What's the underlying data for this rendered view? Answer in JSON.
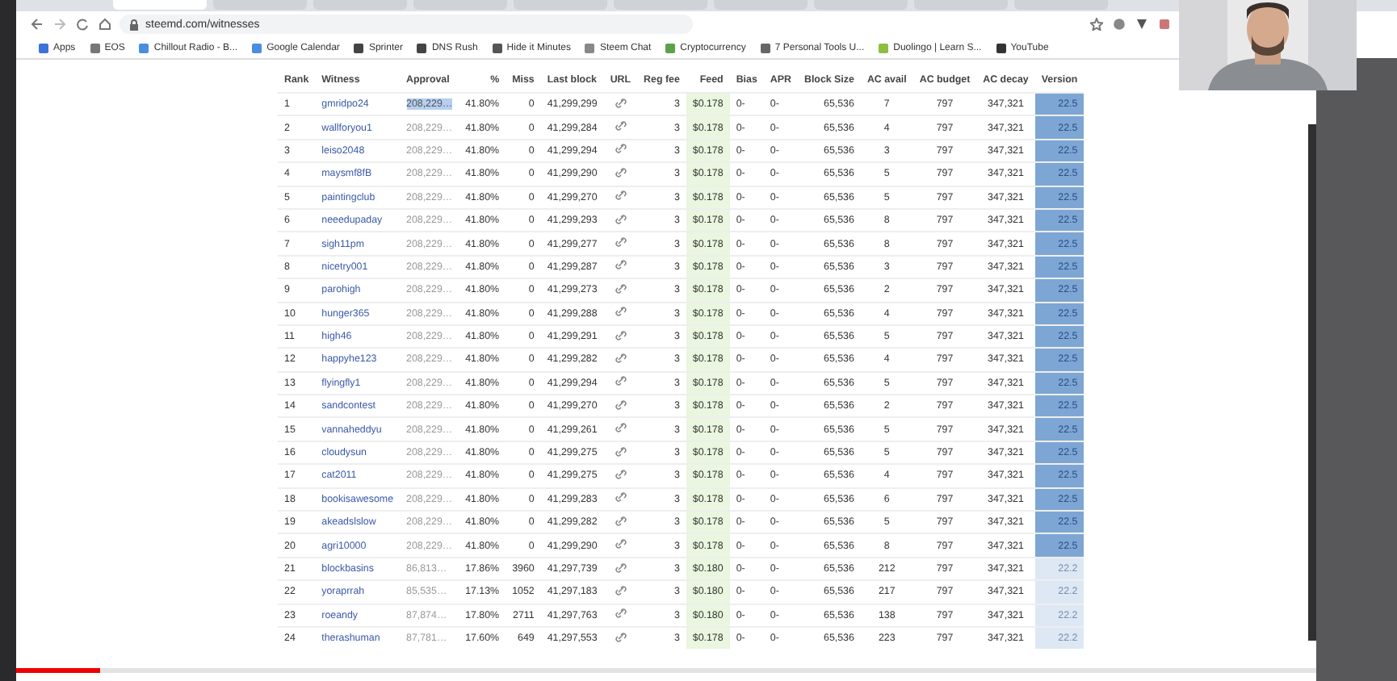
{
  "browser": {
    "tabs": [
      {
        "selected": true
      },
      {
        "selected": false
      },
      {
        "selected": false
      },
      {
        "selected": false
      },
      {
        "selected": false
      },
      {
        "selected": false
      },
      {
        "selected": false
      },
      {
        "selected": false
      },
      {
        "selected": false
      },
      {
        "selected": false
      }
    ],
    "address": "steemd.com/witnesses",
    "bookmarks": [
      "Apps",
      "EOS",
      "Chillout Radio - B...",
      "Google Calendar",
      "Sprinter",
      "DNS Rush",
      "Hide it Minutes",
      "Steem Chat",
      "Cryptocurrency",
      "7 Personal Tools U...",
      "Duolingo | Learn S...",
      "YouTube"
    ]
  },
  "table": {
    "columns": [
      "Rank",
      "Witness",
      "Approval",
      "%",
      "Miss",
      "Last block",
      "URL",
      "Reg fee",
      "Feed",
      "Bias",
      "APR",
      "Block Size",
      "AC avail",
      "AC budget",
      "AC decay",
      "Version"
    ],
    "rows": [
      {
        "rank": "1",
        "witness": "gmridpo24",
        "approval": "208,229…",
        "approval_selected": true,
        "pct": "41.80%",
        "miss": "0",
        "last_block": "41,299,299",
        "reg_fee": "3",
        "feed": "$0.178",
        "bias": "0-",
        "apr": "0-",
        "block_size": "65,536",
        "ac_avail": "7",
        "ac_budget": "797",
        "ac_decay": "347,321",
        "version": "22.5",
        "current": true
      },
      {
        "rank": "2",
        "witness": "wallforyou1",
        "approval": "208,229…",
        "approval_selected": false,
        "pct": "41.80%",
        "miss": "0",
        "last_block": "41,299,284",
        "reg_fee": "3",
        "feed": "$0.178",
        "bias": "0-",
        "apr": "0-",
        "block_size": "65,536",
        "ac_avail": "4",
        "ac_budget": "797",
        "ac_decay": "347,321",
        "version": "22.5",
        "current": true
      },
      {
        "rank": "3",
        "witness": "leiso2048",
        "approval": "208,229…",
        "approval_selected": false,
        "pct": "41.80%",
        "miss": "0",
        "last_block": "41,299,294",
        "reg_fee": "3",
        "feed": "$0.178",
        "bias": "0-",
        "apr": "0-",
        "block_size": "65,536",
        "ac_avail": "3",
        "ac_budget": "797",
        "ac_decay": "347,321",
        "version": "22.5",
        "current": true
      },
      {
        "rank": "4",
        "witness": "maysmf8fB",
        "approval": "208,229…",
        "approval_selected": false,
        "pct": "41.80%",
        "miss": "0",
        "last_block": "41,299,290",
        "reg_fee": "3",
        "feed": "$0.178",
        "bias": "0-",
        "apr": "0-",
        "block_size": "65,536",
        "ac_avail": "5",
        "ac_budget": "797",
        "ac_decay": "347,321",
        "version": "22.5",
        "current": true
      },
      {
        "rank": "5",
        "witness": "paintingclub",
        "approval": "208,229…",
        "approval_selected": false,
        "pct": "41.80%",
        "miss": "0",
        "last_block": "41,299,270",
        "reg_fee": "3",
        "feed": "$0.178",
        "bias": "0-",
        "apr": "0-",
        "block_size": "65,536",
        "ac_avail": "5",
        "ac_budget": "797",
        "ac_decay": "347,321",
        "version": "22.5",
        "current": true
      },
      {
        "rank": "6",
        "witness": "neeedupaday",
        "approval": "208,229…",
        "approval_selected": false,
        "pct": "41.80%",
        "miss": "0",
        "last_block": "41,299,293",
        "reg_fee": "3",
        "feed": "$0.178",
        "bias": "0-",
        "apr": "0-",
        "block_size": "65,536",
        "ac_avail": "8",
        "ac_budget": "797",
        "ac_decay": "347,321",
        "version": "22.5",
        "current": true
      },
      {
        "rank": "7",
        "witness": "sigh11pm",
        "approval": "208,229…",
        "approval_selected": false,
        "pct": "41.80%",
        "miss": "0",
        "last_block": "41,299,277",
        "reg_fee": "3",
        "feed": "$0.178",
        "bias": "0-",
        "apr": "0-",
        "block_size": "65,536",
        "ac_avail": "8",
        "ac_budget": "797",
        "ac_decay": "347,321",
        "version": "22.5",
        "current": true
      },
      {
        "rank": "8",
        "witness": "nicetry001",
        "approval": "208,229…",
        "approval_selected": false,
        "pct": "41.80%",
        "miss": "0",
        "last_block": "41,299,287",
        "reg_fee": "3",
        "feed": "$0.178",
        "bias": "0-",
        "apr": "0-",
        "block_size": "65,536",
        "ac_avail": "3",
        "ac_budget": "797",
        "ac_decay": "347,321",
        "version": "22.5",
        "current": true
      },
      {
        "rank": "9",
        "witness": "parohigh",
        "approval": "208,229…",
        "approval_selected": false,
        "pct": "41.80%",
        "miss": "0",
        "last_block": "41,299,273",
        "reg_fee": "3",
        "feed": "$0.178",
        "bias": "0-",
        "apr": "0-",
        "block_size": "65,536",
        "ac_avail": "2",
        "ac_budget": "797",
        "ac_decay": "347,321",
        "version": "22.5",
        "current": true
      },
      {
        "rank": "10",
        "witness": "hunger365",
        "approval": "208,229…",
        "approval_selected": false,
        "pct": "41.80%",
        "miss": "0",
        "last_block": "41,299,288",
        "reg_fee": "3",
        "feed": "$0.178",
        "bias": "0-",
        "apr": "0-",
        "block_size": "65,536",
        "ac_avail": "4",
        "ac_budget": "797",
        "ac_decay": "347,321",
        "version": "22.5",
        "current": true
      },
      {
        "rank": "11",
        "witness": "high46",
        "approval": "208,229…",
        "approval_selected": false,
        "pct": "41.80%",
        "miss": "0",
        "last_block": "41,299,291",
        "reg_fee": "3",
        "feed": "$0.178",
        "bias": "0-",
        "apr": "0-",
        "block_size": "65,536",
        "ac_avail": "5",
        "ac_budget": "797",
        "ac_decay": "347,321",
        "version": "22.5",
        "current": true
      },
      {
        "rank": "12",
        "witness": "happyhe123",
        "approval": "208,229…",
        "approval_selected": false,
        "pct": "41.80%",
        "miss": "0",
        "last_block": "41,299,282",
        "reg_fee": "3",
        "feed": "$0.178",
        "bias": "0-",
        "apr": "0-",
        "block_size": "65,536",
        "ac_avail": "4",
        "ac_budget": "797",
        "ac_decay": "347,321",
        "version": "22.5",
        "current": true
      },
      {
        "rank": "13",
        "witness": "flyingfly1",
        "approval": "208,229…",
        "approval_selected": false,
        "pct": "41.80%",
        "miss": "0",
        "last_block": "41,299,294",
        "reg_fee": "3",
        "feed": "$0.178",
        "bias": "0-",
        "apr": "0-",
        "block_size": "65,536",
        "ac_avail": "5",
        "ac_budget": "797",
        "ac_decay": "347,321",
        "version": "22.5",
        "current": true
      },
      {
        "rank": "14",
        "witness": "sandcontest",
        "approval": "208,229…",
        "approval_selected": false,
        "pct": "41.80%",
        "miss": "0",
        "last_block": "41,299,270",
        "reg_fee": "3",
        "feed": "$0.178",
        "bias": "0-",
        "apr": "0-",
        "block_size": "65,536",
        "ac_avail": "2",
        "ac_budget": "797",
        "ac_decay": "347,321",
        "version": "22.5",
        "current": true
      },
      {
        "rank": "15",
        "witness": "vannaheddyu",
        "approval": "208,229…",
        "approval_selected": false,
        "pct": "41.80%",
        "miss": "0",
        "last_block": "41,299,261",
        "reg_fee": "3",
        "feed": "$0.178",
        "bias": "0-",
        "apr": "0-",
        "block_size": "65,536",
        "ac_avail": "5",
        "ac_budget": "797",
        "ac_decay": "347,321",
        "version": "22.5",
        "current": true
      },
      {
        "rank": "16",
        "witness": "cloudysun",
        "approval": "208,229…",
        "approval_selected": false,
        "pct": "41.80%",
        "miss": "0",
        "last_block": "41,299,275",
        "reg_fee": "3",
        "feed": "$0.178",
        "bias": "0-",
        "apr": "0-",
        "block_size": "65,536",
        "ac_avail": "5",
        "ac_budget": "797",
        "ac_decay": "347,321",
        "version": "22.5",
        "current": true
      },
      {
        "rank": "17",
        "witness": "cat2011",
        "approval": "208,229…",
        "approval_selected": false,
        "pct": "41.80%",
        "miss": "0",
        "last_block": "41,299,275",
        "reg_fee": "3",
        "feed": "$0.178",
        "bias": "0-",
        "apr": "0-",
        "block_size": "65,536",
        "ac_avail": "4",
        "ac_budget": "797",
        "ac_decay": "347,321",
        "version": "22.5",
        "current": true
      },
      {
        "rank": "18",
        "witness": "bookisawesome",
        "approval": "208,229…",
        "approval_selected": false,
        "pct": "41.80%",
        "miss": "0",
        "last_block": "41,299,283",
        "reg_fee": "3",
        "feed": "$0.178",
        "bias": "0-",
        "apr": "0-",
        "block_size": "65,536",
        "ac_avail": "6",
        "ac_budget": "797",
        "ac_decay": "347,321",
        "version": "22.5",
        "current": true
      },
      {
        "rank": "19",
        "witness": "akeadslslow",
        "approval": "208,229…",
        "approval_selected": false,
        "pct": "41.80%",
        "miss": "0",
        "last_block": "41,299,282",
        "reg_fee": "3",
        "feed": "$0.178",
        "bias": "0-",
        "apr": "0-",
        "block_size": "65,536",
        "ac_avail": "5",
        "ac_budget": "797",
        "ac_decay": "347,321",
        "version": "22.5",
        "current": true
      },
      {
        "rank": "20",
        "witness": "agri10000",
        "approval": "208,229…",
        "approval_selected": false,
        "pct": "41.80%",
        "miss": "0",
        "last_block": "41,299,290",
        "reg_fee": "3",
        "feed": "$0.178",
        "bias": "0-",
        "apr": "0-",
        "block_size": "65,536",
        "ac_avail": "8",
        "ac_budget": "797",
        "ac_decay": "347,321",
        "version": "22.5",
        "current": true
      },
      {
        "rank": "21",
        "witness": "blockbasins",
        "approval": "86,813…",
        "approval_selected": false,
        "pct": "17.86%",
        "miss": "3960",
        "last_block": "41,297,739",
        "reg_fee": "3",
        "feed": "$0.180",
        "bias": "0-",
        "apr": "0-",
        "block_size": "65,536",
        "ac_avail": "212",
        "ac_budget": "797",
        "ac_decay": "347,321",
        "version": "22.2",
        "current": false
      },
      {
        "rank": "22",
        "witness": "yoraprrah",
        "approval": "85,535…",
        "approval_selected": false,
        "pct": "17.13%",
        "miss": "1052",
        "last_block": "41,297,183",
        "reg_fee": "3",
        "feed": "$0.180",
        "bias": "0-",
        "apr": "0-",
        "block_size": "65,536",
        "ac_avail": "217",
        "ac_budget": "797",
        "ac_decay": "347,321",
        "version": "22.2",
        "current": false
      },
      {
        "rank": "23",
        "witness": "roeandy",
        "approval": "87,874…",
        "approval_selected": false,
        "pct": "17.80%",
        "miss": "2711",
        "last_block": "41,297,763",
        "reg_fee": "3",
        "feed": "$0.180",
        "bias": "0-",
        "apr": "0-",
        "block_size": "65,536",
        "ac_avail": "138",
        "ac_budget": "797",
        "ac_decay": "347,321",
        "version": "22.2",
        "current": false
      },
      {
        "rank": "24",
        "witness": "therashuman",
        "approval": "87,781…",
        "approval_selected": false,
        "pct": "17.60%",
        "miss": "649",
        "last_block": "41,297,553",
        "reg_fee": "3",
        "feed": "$0.178",
        "bias": "0-",
        "apr": "0-",
        "block_size": "65,536",
        "ac_avail": "223",
        "ac_budget": "797",
        "ac_decay": "347,321",
        "version": "22.2",
        "current": false
      }
    ]
  },
  "video": {
    "progress": {
      "level": 0.065
    }
  }
}
